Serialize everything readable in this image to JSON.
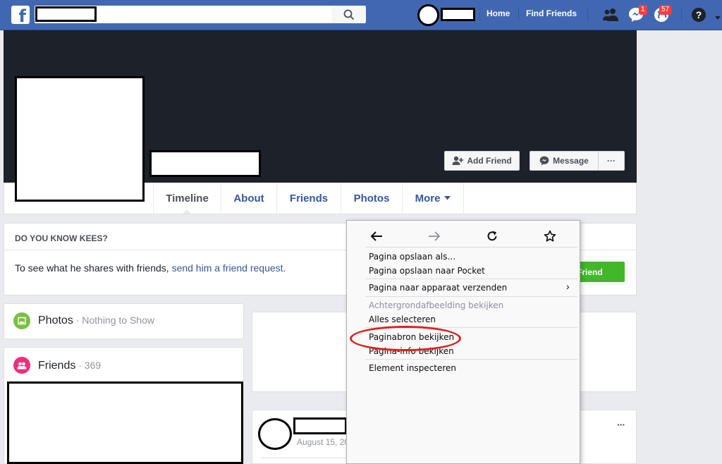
{
  "topbar": {
    "logo": "f",
    "search_icon": "search-icon",
    "nav": [
      "Home",
      "Find Friends"
    ],
    "badges": {
      "messages": "1",
      "notifications": "57"
    }
  },
  "profile": {
    "buttons": {
      "add_friend": "Add Friend",
      "message": "Message",
      "more": "···"
    },
    "tabs": [
      "Timeline",
      "About",
      "Friends",
      "Photos",
      "More"
    ]
  },
  "know_card": {
    "header": "DO YOU KNOW KEES?",
    "text": "To see what he shares with friends, ",
    "link": "send him a friend request.",
    "button": "Add Friend"
  },
  "sidebar": {
    "photos_label": "Photos",
    "photos_status": " · Nothing to Show",
    "friends_label": "Friends",
    "friends_count": " · 369"
  },
  "post": {
    "date": "August 15, 20",
    "more": "···"
  },
  "context_menu": {
    "items": [
      "Pagina opslaan als…",
      "Pagina opslaan naar Pocket",
      "Pagina naar apparaat verzenden",
      "Achtergrondafbeelding bekijken",
      "Alles selecteren",
      "Paginabron bekijken",
      "Pagina-info bekijken",
      "Element inspecteren"
    ],
    "submenu_arrow": "›"
  },
  "colors": {
    "facebook_blue": "#4267b2",
    "link_blue": "#365899",
    "highlight_red": "#e0201a",
    "add_friend_green": "#42b72a"
  }
}
